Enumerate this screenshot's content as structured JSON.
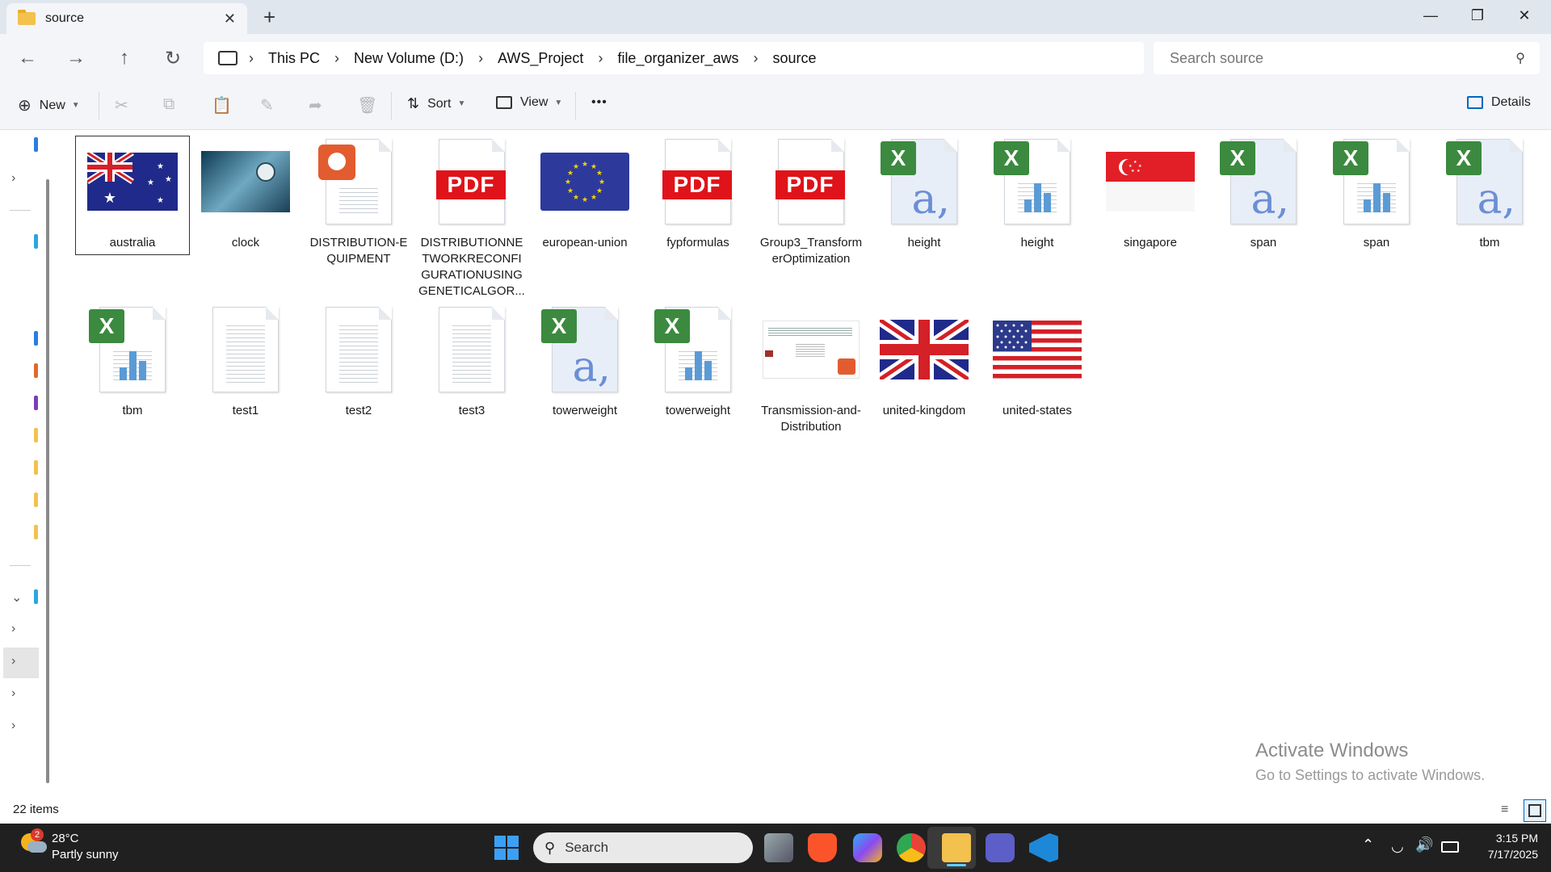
{
  "window": {
    "tab_title": "source",
    "new_tab_icon": "plus-icon",
    "controls": [
      "minimize-icon",
      "restore-icon",
      "close-icon"
    ]
  },
  "address": {
    "crumbs": [
      "This PC",
      "New Volume (D:)",
      "AWS_Project",
      "file_organizer_aws",
      "source"
    ],
    "search_placeholder": "Search source"
  },
  "toolbar": {
    "new_label": "New",
    "sort_label": "Sort",
    "view_label": "View",
    "more_label": "•••",
    "details_label": "Details"
  },
  "files": [
    {
      "name": "australia",
      "kind": "flag-au",
      "selected": true
    },
    {
      "name": "clock",
      "kind": "photo"
    },
    {
      "name": "DISTRIBUTION-EQUIPMENT",
      "kind": "pptx"
    },
    {
      "name": "DISTRIBUTIONNETWORKRECONFIGURATIONUSINGGENETICALGOR...",
      "kind": "pdf"
    },
    {
      "name": "european-union",
      "kind": "flag-eu"
    },
    {
      "name": "fypformulas",
      "kind": "pdf"
    },
    {
      "name": "Group3_TransformerOptimization",
      "kind": "pdf"
    },
    {
      "name": "height",
      "kind": "csv"
    },
    {
      "name": "height",
      "kind": "xlsx"
    },
    {
      "name": "singapore",
      "kind": "flag-sg"
    },
    {
      "name": "span",
      "kind": "csv"
    },
    {
      "name": "span",
      "kind": "xlsx"
    },
    {
      "name": "tbm",
      "kind": "csv"
    },
    {
      "name": "tbm",
      "kind": "xlsx"
    },
    {
      "name": "test1",
      "kind": "txt"
    },
    {
      "name": "test2",
      "kind": "txt"
    },
    {
      "name": "test3",
      "kind": "txt"
    },
    {
      "name": "towerweight",
      "kind": "csv"
    },
    {
      "name": "towerweight",
      "kind": "xlsx"
    },
    {
      "name": "Transmission-and-Distribution",
      "kind": "pptx-thumb"
    },
    {
      "name": "united-kingdom",
      "kind": "flag-uk"
    },
    {
      "name": "united-states",
      "kind": "flag-us"
    }
  ],
  "status": {
    "item_count": "22 items"
  },
  "watermark": {
    "line1": "Activate Windows",
    "line2": "Go to Settings to activate Windows."
  },
  "taskbar": {
    "weather_temp": "28°C",
    "weather_desc": "Partly sunny",
    "weather_badge": "2",
    "search_label": "Search",
    "time": "3:15 PM",
    "date": "7/17/2025"
  },
  "colors": {
    "accent": "#0067c0",
    "pdf_red": "#e0131a",
    "excel_green": "#3b8a3f",
    "taskbar": "#202020"
  }
}
